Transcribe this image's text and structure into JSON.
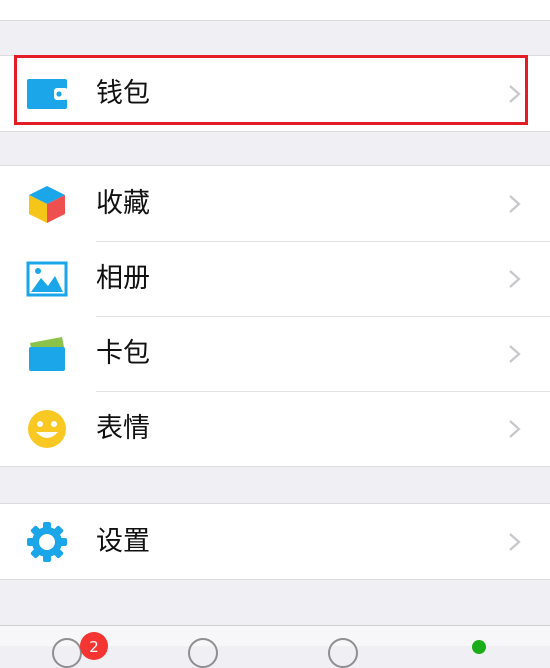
{
  "wallet": {
    "label": "钱包",
    "icon": "wallet-icon"
  },
  "menu": [
    {
      "label": "收藏",
      "icon": "favorites-cube-icon"
    },
    {
      "label": "相册",
      "icon": "album-picture-icon"
    },
    {
      "label": "卡包",
      "icon": "card-wallet-icon"
    },
    {
      "label": "表情",
      "icon": "emoji-smile-icon"
    }
  ],
  "settings": {
    "label": "设置",
    "icon": "gear-icon"
  },
  "tabbar": {
    "badge_count": "2"
  },
  "colors": {
    "highlight": "#e31c25",
    "accent_blue": "#1aa6e8",
    "badge": "#f43531"
  }
}
